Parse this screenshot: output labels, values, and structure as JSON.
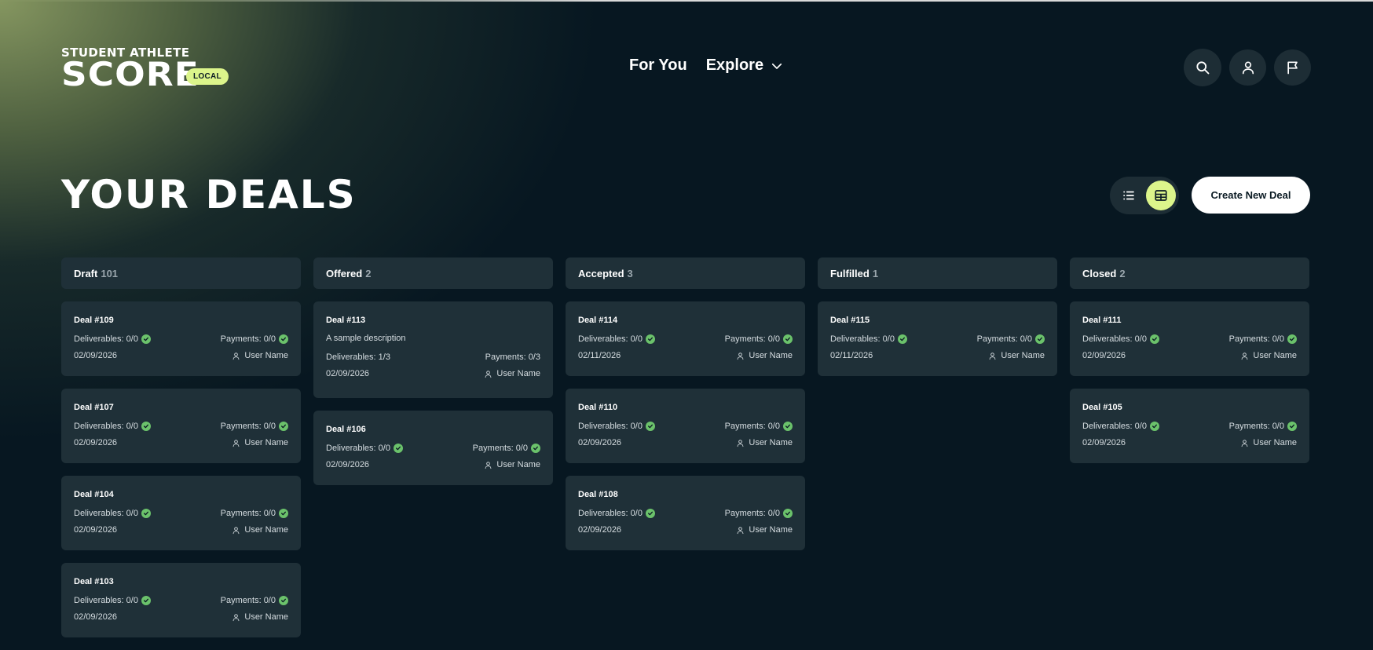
{
  "brand": {
    "top": "STUDENT ATHLETE",
    "main": "SCORE",
    "env_badge": "LOCAL"
  },
  "nav": {
    "for_you": "For You",
    "explore": "Explore"
  },
  "header_icons": [
    "search-icon",
    "user-icon",
    "flag-icon"
  ],
  "page": {
    "title": "YOUR DEALS",
    "create_label": "Create New Deal"
  },
  "view_toggle": {
    "selected": "board",
    "options": [
      "list",
      "board"
    ]
  },
  "colors": {
    "accent": "#dcf58b",
    "background": "#071721",
    "card": "#1f3038",
    "success": "#6bc26b"
  },
  "columns": [
    {
      "name": "Draft",
      "count": "101",
      "cards": [
        {
          "title": "Deal #109",
          "deliverables": "Deliverables: 0/0",
          "payments": "Payments: 0/0",
          "date": "02/09/2026",
          "user": "User Name"
        },
        {
          "title": "Deal #107",
          "deliverables": "Deliverables: 0/0",
          "payments": "Payments: 0/0",
          "date": "02/09/2026",
          "user": "User Name"
        },
        {
          "title": "Deal #104",
          "deliverables": "Deliverables: 0/0",
          "payments": "Payments: 0/0",
          "date": "02/09/2026",
          "user": "User Name"
        },
        {
          "title": "Deal #103",
          "deliverables": "Deliverables: 0/0",
          "payments": "Payments: 0/0",
          "date": "02/09/2026",
          "user": "User Name"
        }
      ]
    },
    {
      "name": "Offered",
      "count": "2",
      "cards": [
        {
          "title": "Deal #113",
          "description": "A sample description",
          "deliverables": "Deliverables: 1/3",
          "payments": "Payments: 0/3",
          "date": "02/09/2026",
          "user": "User Name"
        },
        {
          "title": "Deal #106",
          "deliverables": "Deliverables: 0/0",
          "payments": "Payments: 0/0",
          "date": "02/09/2026",
          "user": "User Name"
        }
      ]
    },
    {
      "name": "Accepted",
      "count": "3",
      "cards": [
        {
          "title": "Deal #114",
          "deliverables": "Deliverables: 0/0",
          "payments": "Payments: 0/0",
          "date": "02/11/2026",
          "user": "User Name"
        },
        {
          "title": "Deal #110",
          "deliverables": "Deliverables: 0/0",
          "payments": "Payments: 0/0",
          "date": "02/09/2026",
          "user": "User Name"
        },
        {
          "title": "Deal #108",
          "deliverables": "Deliverables: 0/0",
          "payments": "Payments: 0/0",
          "date": "02/09/2026",
          "user": "User Name"
        }
      ]
    },
    {
      "name": "Fulfilled",
      "count": "1",
      "cards": [
        {
          "title": "Deal #115",
          "deliverables": "Deliverables: 0/0",
          "payments": "Payments: 0/0",
          "date": "02/11/2026",
          "user": "User Name"
        }
      ]
    },
    {
      "name": "Closed",
      "count": "2",
      "cards": [
        {
          "title": "Deal #111",
          "deliverables": "Deliverables: 0/0",
          "payments": "Payments: 0/0",
          "date": "02/09/2026",
          "user": "User Name"
        },
        {
          "title": "Deal #105",
          "deliverables": "Deliverables: 0/0",
          "payments": "Payments: 0/0",
          "date": "02/09/2026",
          "user": "User Name"
        }
      ]
    }
  ]
}
